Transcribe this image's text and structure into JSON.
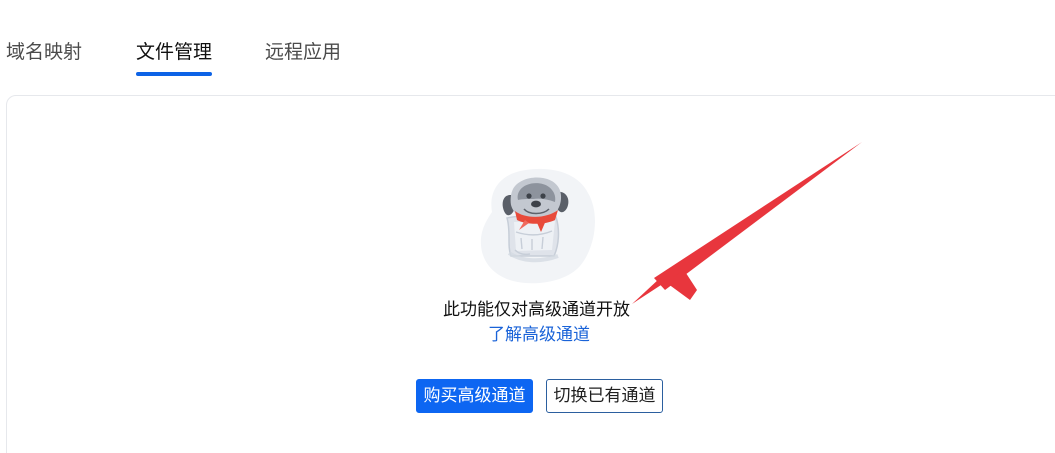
{
  "tabs": [
    {
      "label": "域名映射",
      "active": false
    },
    {
      "label": "文件管理",
      "active": true
    },
    {
      "label": "远程应用",
      "active": false
    }
  ],
  "main": {
    "message": "此功能仅对高级通道开放",
    "learn_more_link": "了解高级通道",
    "buy_button": "购买高级通道",
    "switch_button": "切换已有通道"
  },
  "colors": {
    "primary": "#0d66f2",
    "link": "#1a63d8",
    "tab_active_underline": "#0d63e6",
    "annotation_arrow": "#e8363d",
    "dog_scarf": "#e84a3a"
  },
  "icons": {
    "illustration": "dog-in-box-illustration",
    "annotation": "red-arrow-annotation"
  }
}
